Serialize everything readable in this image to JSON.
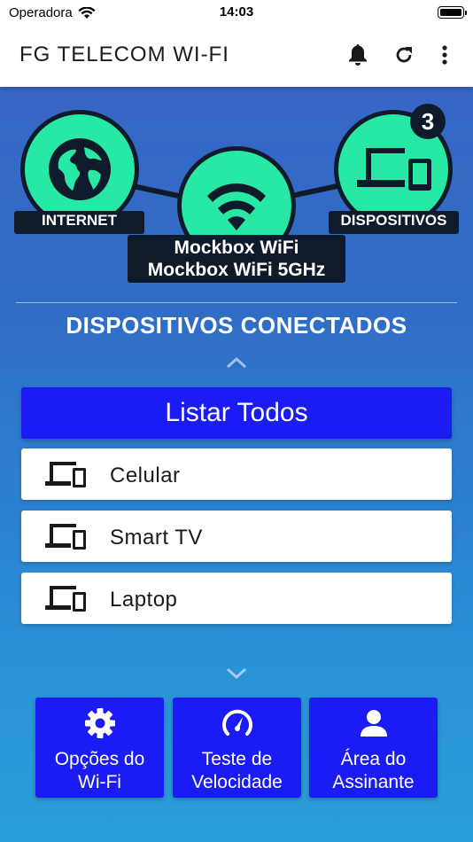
{
  "status_bar": {
    "carrier": "Operadora",
    "time": "14:03"
  },
  "app_bar": {
    "title": "FG TELECOM WI-FI",
    "icons": [
      "bell-icon",
      "refresh-icon",
      "more-vert-icon"
    ]
  },
  "diagram": {
    "internet_label": "INTERNET",
    "devices_label": "DISPOSITIVOS",
    "devices_count": "3",
    "ssid_24": "Mockbox WiFi",
    "ssid_5": "Mockbox WiFi 5GHz",
    "node_color": "#27e8a4"
  },
  "devices_section": {
    "title": "DISPOSITIVOS CONECTADOS",
    "list_all": "Listar Todos",
    "devices": [
      {
        "name": "Celular",
        "icon": "devices-icon"
      },
      {
        "name": "Smart TV",
        "icon": "devices-icon"
      },
      {
        "name": "Laptop",
        "icon": "devices-icon"
      }
    ]
  },
  "actions": [
    {
      "line1": "Opções do",
      "line2": "Wi-Fi",
      "icon": "gear-icon"
    },
    {
      "line1": "Teste de",
      "line2": "Velocidade",
      "icon": "speedometer-icon"
    },
    {
      "line1": "Área do",
      "line2": "Assinante",
      "icon": "person-icon"
    }
  ],
  "colors": {
    "primary_button": "#1b1cf5",
    "dark": "#0f1a2b"
  }
}
